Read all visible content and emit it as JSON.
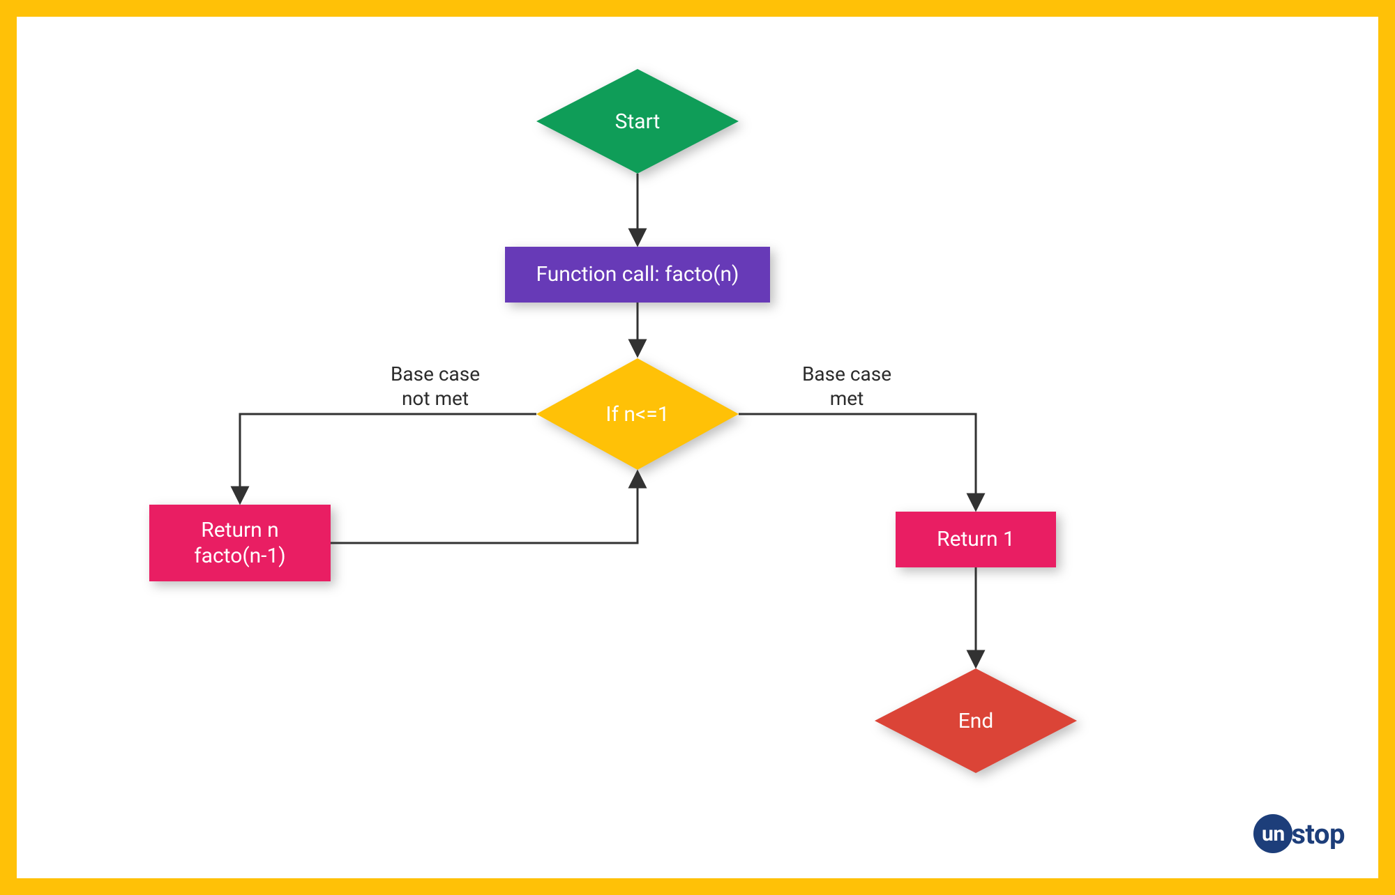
{
  "colors": {
    "border": "#FFC107",
    "start": "#0F9D58",
    "process": "#673AB7",
    "decision": "#FFC107",
    "return": "#E91E63",
    "end": "#DB4437",
    "arrow": "#323232",
    "text_dark": "#2b2b2b",
    "logo": "#1d3e7a"
  },
  "nodes": {
    "start": {
      "label": "Start",
      "shape": "diamond",
      "color_key": "start"
    },
    "function_call": {
      "label": "Function call: facto(n)",
      "shape": "rect",
      "color_key": "process"
    },
    "decision": {
      "label": "If n<=1",
      "shape": "diamond",
      "color_key": "decision"
    },
    "return_recursive": {
      "label": "Return n\nfacto(n-1)",
      "shape": "rect",
      "color_key": "return"
    },
    "return_one": {
      "label": "Return 1",
      "shape": "rect",
      "color_key": "return"
    },
    "end": {
      "label": "End",
      "shape": "diamond",
      "color_key": "end"
    }
  },
  "edges": {
    "not_met": {
      "label": "Base case\nnot met"
    },
    "met": {
      "label": "Base case\nmet"
    }
  },
  "brand": {
    "disc": "un",
    "rest": "stop"
  }
}
